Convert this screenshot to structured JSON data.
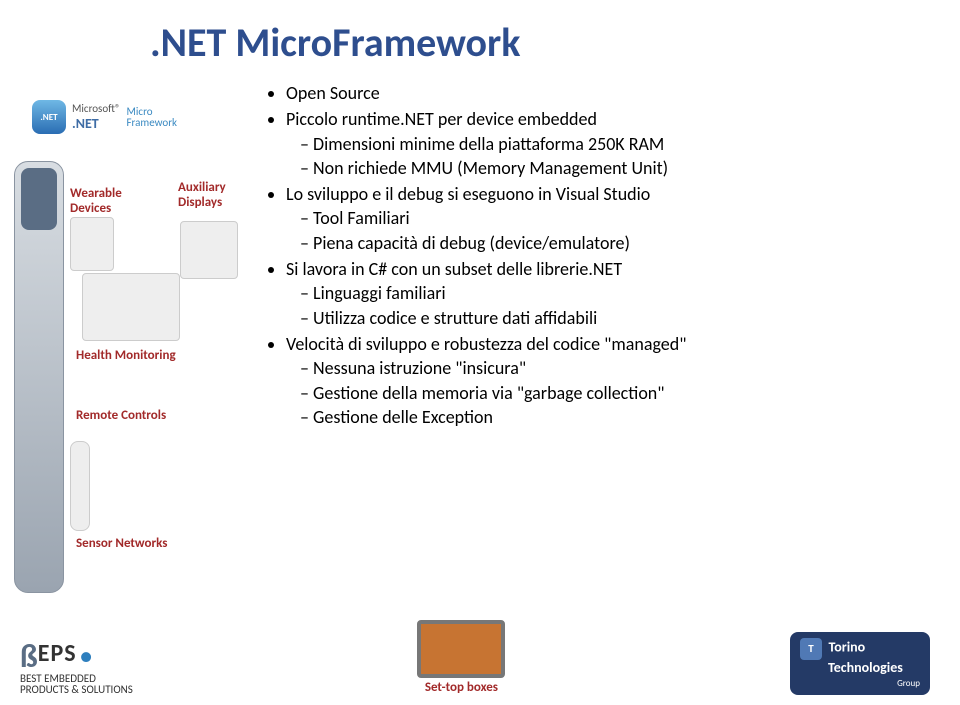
{
  "title": ".NET MicroFramework",
  "logo": {
    "microsoft": "Microsoft®",
    "dotnet": ".NET",
    "micro": "Micro",
    "framework": "Framework"
  },
  "leftLabels": {
    "wearable1": "Wearable",
    "wearable2": "Devices",
    "aux1": "Auxiliary",
    "aux2": "Displays",
    "health": "Health Monitoring",
    "remote": "Remote Controls",
    "sensor": "Sensor Networks"
  },
  "bullets": {
    "b1": "Open Source",
    "b2": "Piccolo runtime.NET per device embedded",
    "b2s1": "Dimensioni minime della piattaforma 250K RAM",
    "b2s2": "Non richiede MMU (Memory Management Unit)",
    "b3": "Lo sviluppo e il debug si eseguono in Visual Studio",
    "b3s1": "Tool Familiari",
    "b3s2": "Piena capacità di debug (device/emulatore)",
    "b4": "Si lavora in C# con un subset delle librerie.NET",
    "b4s1": "Linguaggi familiari",
    "b4s2": "Utilizza codice e strutture dati affidabili",
    "b5": "Velocità di sviluppo e robustezza del codice \"managed\"",
    "b5s1": "Nessuna istruzione \"insicura\"",
    "b5s2": "Gestione della memoria via \"garbage collection\"",
    "b5s3": "Gestione delle Exception"
  },
  "footer": {
    "beps1": "EPS",
    "beps2": "BEST EMBEDDED",
    "beps3": "PRODUCTS & SOLUTIONS",
    "settop": "Set-top boxes",
    "ttg1": "Torino",
    "ttg2": "Technologies",
    "ttg3": "Group"
  }
}
